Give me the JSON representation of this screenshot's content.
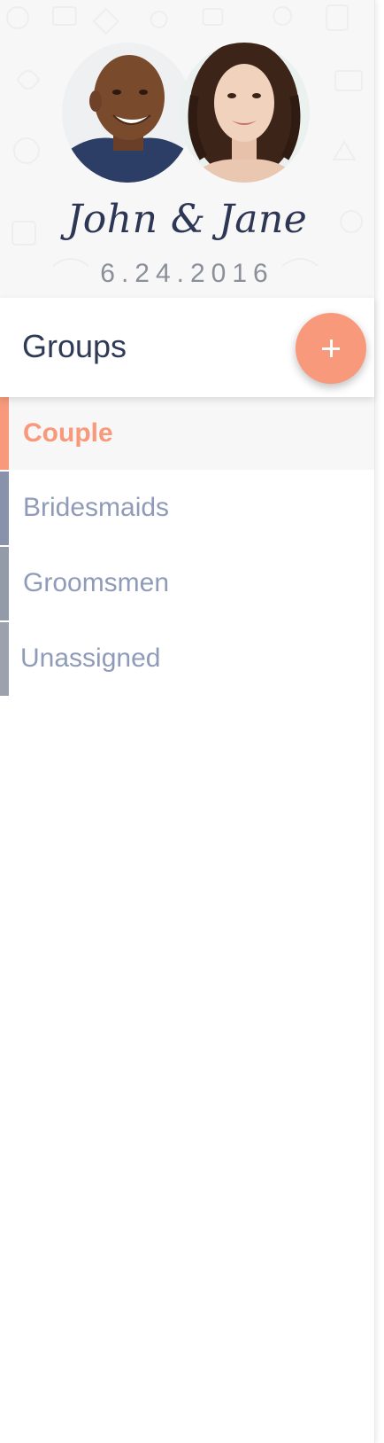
{
  "header": {
    "couple_names": "John & Jane",
    "wedding_date": "6.24.2016",
    "groom_avatar": "groom-photo",
    "bride_avatar": "bride-photo"
  },
  "groups": {
    "title": "Groups",
    "add_button_icon": "plus-icon",
    "items": [
      {
        "label": "Couple",
        "active": true,
        "color": "#f7997a"
      },
      {
        "label": "Bridesmaids",
        "active": false,
        "color": "#8892aa"
      },
      {
        "label": "Groomsmen",
        "active": false,
        "color": "#939ba9"
      },
      {
        "label": "Unassigned",
        "active": false,
        "color": "#9ba2ad"
      }
    ]
  },
  "colors": {
    "accent": "#f7997a",
    "title": "#2f3a56",
    "inactive_label": "#8f9bb8",
    "header_bg": "#f7f7f7"
  }
}
